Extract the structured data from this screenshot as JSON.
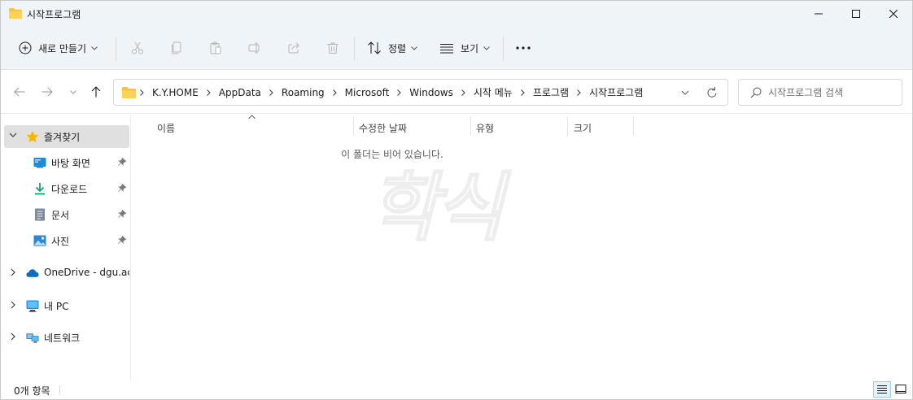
{
  "window": {
    "title": "시작프로그램"
  },
  "commandbar": {
    "new_label": "새로 만들기",
    "sort_label": "정렬",
    "view_label": "보기",
    "more_label": "..."
  },
  "address": {
    "crumbs": [
      "K.Y.HOME",
      "AppData",
      "Roaming",
      "Microsoft",
      "Windows",
      "시작 메뉴",
      "프로그램",
      "시작프로그램"
    ]
  },
  "search": {
    "placeholder": "시작프로그램 검색"
  },
  "sidebar": {
    "quick_access": "즐겨찾기",
    "items": [
      {
        "label": "바탕 화면"
      },
      {
        "label": "다운로드"
      },
      {
        "label": "문서"
      },
      {
        "label": "사진"
      }
    ],
    "onedrive": "OneDrive - dgu.ac.kr",
    "this_pc": "내 PC",
    "network": "네트워크"
  },
  "columns": {
    "name": "이름",
    "modified": "수정한 날짜",
    "type": "유형",
    "size": "크기"
  },
  "content": {
    "empty_message": "이 폴더는 비어 있습니다.",
    "watermark": "학식"
  },
  "status": {
    "item_count": "0개 항목"
  },
  "colors": {
    "titlebar_bg": "#eff4f9",
    "folder_yellow": "#f8c33c",
    "accent_blue": "#0a64c8",
    "selected_bg": "#e0e0e0"
  }
}
